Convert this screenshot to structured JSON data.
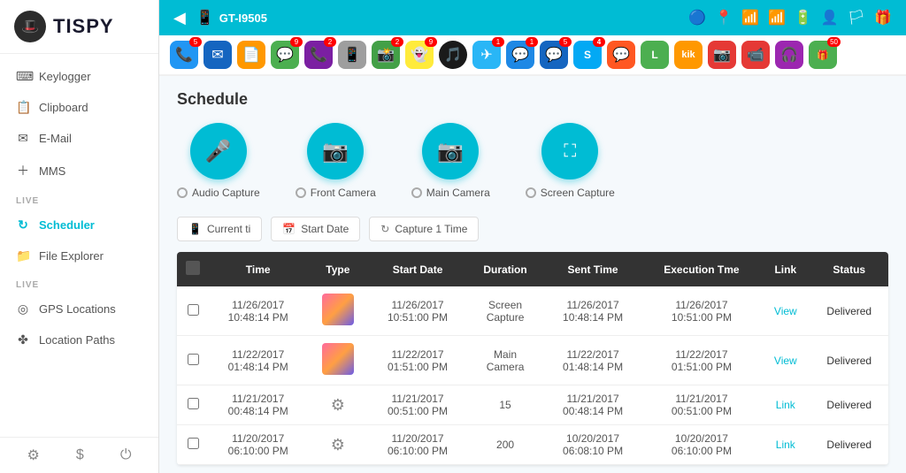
{
  "sidebar": {
    "logo_text": "TISPY",
    "items": [
      {
        "label": "Keylogger",
        "icon": "⌨",
        "active": false,
        "section": null
      },
      {
        "label": "Clipboard",
        "icon": "📋",
        "active": false,
        "section": null
      },
      {
        "label": "E-Mail",
        "icon": "✉",
        "active": false,
        "section": null
      },
      {
        "label": "MMS",
        "icon": "➕",
        "active": false,
        "section": null
      },
      {
        "label": "LIVE",
        "section": true
      },
      {
        "label": "Scheduler",
        "icon": "↻",
        "active": true,
        "section": false
      },
      {
        "label": "File Explorer",
        "icon": "📁",
        "active": false,
        "section": false
      },
      {
        "label": "LIVE",
        "section": true
      },
      {
        "label": "GPS Locations",
        "icon": "◎",
        "active": false,
        "section": false
      },
      {
        "label": "Location Paths",
        "icon": "✤",
        "active": false,
        "section": false
      }
    ],
    "footer": {
      "settings": "⚙",
      "dollar": "$",
      "power": "⏻"
    }
  },
  "topbar": {
    "device_name": "GT-I9505",
    "back_icon": "◀",
    "icons": [
      "🔵",
      "📍",
      "📶",
      "📶",
      "🔋",
      "👤",
      "🏳"
    ]
  },
  "schedule": {
    "title": "Schedule",
    "icons": [
      {
        "label": "Audio Capture",
        "icon": "🎤"
      },
      {
        "label": "Front Camera",
        "icon": "📷"
      },
      {
        "label": "Main Camera",
        "icon": "📷"
      },
      {
        "label": "Screen Capture",
        "icon": "⛶"
      }
    ]
  },
  "filters": [
    {
      "icon": "📱",
      "label": "Current ti"
    },
    {
      "icon": "📅",
      "label": "Start Date"
    },
    {
      "icon": "↻",
      "label": "Capture 1 Time"
    }
  ],
  "table": {
    "headers": [
      "",
      "Time",
      "Type",
      "Start Date",
      "Duration",
      "Sent Time",
      "Execution Tme",
      "Link",
      "Status"
    ],
    "rows": [
      {
        "time": "11/26/2017\n10:48:14 PM",
        "type": "thumb",
        "start_date": "11/26/2017\n10:51:00 PM",
        "duration": "Screen\nCapture",
        "sent_time": "11/26/2017\n10:48:14 PM",
        "exec_time": "11/26/2017\n10:51:00 PM",
        "link": "View",
        "status": "Delivered"
      },
      {
        "time": "11/22/2017\n01:48:14 PM",
        "type": "thumb",
        "start_date": "11/22/2017\n01:51:00 PM",
        "duration": "Main\nCamera",
        "sent_time": "11/22/2017\n01:48:14 PM",
        "exec_time": "11/22/2017\n01:51:00 PM",
        "link": "View",
        "status": "Delivered"
      },
      {
        "time": "11/21/2017\n00:48:14 PM",
        "type": "gear",
        "start_date": "11/21/2017\n00:51:00 PM",
        "duration": "15",
        "sent_time": "11/21/2017\n00:48:14 PM",
        "exec_time": "11/21/2017\n00:51:00 PM",
        "link": "Link",
        "status": "Delivered"
      },
      {
        "time": "11/20/2017\n06:10:00 PM",
        "type": "gear",
        "start_date": "11/20/2017\n06:10:00 PM",
        "duration": "200",
        "sent_time": "10/20/2017\n06:08:10 PM",
        "exec_time": "10/20/2017\n06:10:00 PM",
        "link": "Link",
        "status": "Delivered"
      }
    ]
  },
  "app_icons": [
    {
      "emoji": "📞",
      "color": "#2196F3",
      "badge": "5"
    },
    {
      "emoji": "✉",
      "color": "#1565C0",
      "badge": ""
    },
    {
      "emoji": "📄",
      "color": "#FF9800",
      "badge": ""
    },
    {
      "emoji": "💬",
      "color": "#4CAF50",
      "badge": "9"
    },
    {
      "emoji": "📞",
      "color": "#7B1FA2",
      "badge": "2"
    },
    {
      "emoji": "📱",
      "color": "#9E9E9E",
      "badge": ""
    },
    {
      "emoji": "📸",
      "color": "#43A047",
      "badge": "2"
    },
    {
      "emoji": "👻",
      "color": "#FFEB3B",
      "badge": "9"
    },
    {
      "emoji": "🎵",
      "color": "#E53935",
      "badge": ""
    },
    {
      "emoji": "📨",
      "color": "#1E88E5",
      "badge": "1"
    },
    {
      "emoji": "✈",
      "color": "#29B6F6",
      "badge": "1"
    },
    {
      "emoji": "💬",
      "color": "#2196F3",
      "badge": "5"
    },
    {
      "emoji": "S",
      "color": "#03A9F4",
      "badge": "4"
    },
    {
      "emoji": "💬",
      "color": "#FF5722",
      "badge": ""
    },
    {
      "emoji": "L",
      "color": "#4CAF50",
      "badge": ""
    },
    {
      "emoji": "k",
      "color": "#FF9800",
      "badge": ""
    },
    {
      "emoji": "📷",
      "color": "#E53935",
      "badge": ""
    },
    {
      "emoji": "📹",
      "color": "#E53935",
      "badge": ""
    },
    {
      "emoji": "🎧",
      "color": "#9C27B0",
      "badge": ""
    },
    {
      "emoji": "🎮",
      "color": "#4CAF50",
      "badge": "50"
    }
  ]
}
